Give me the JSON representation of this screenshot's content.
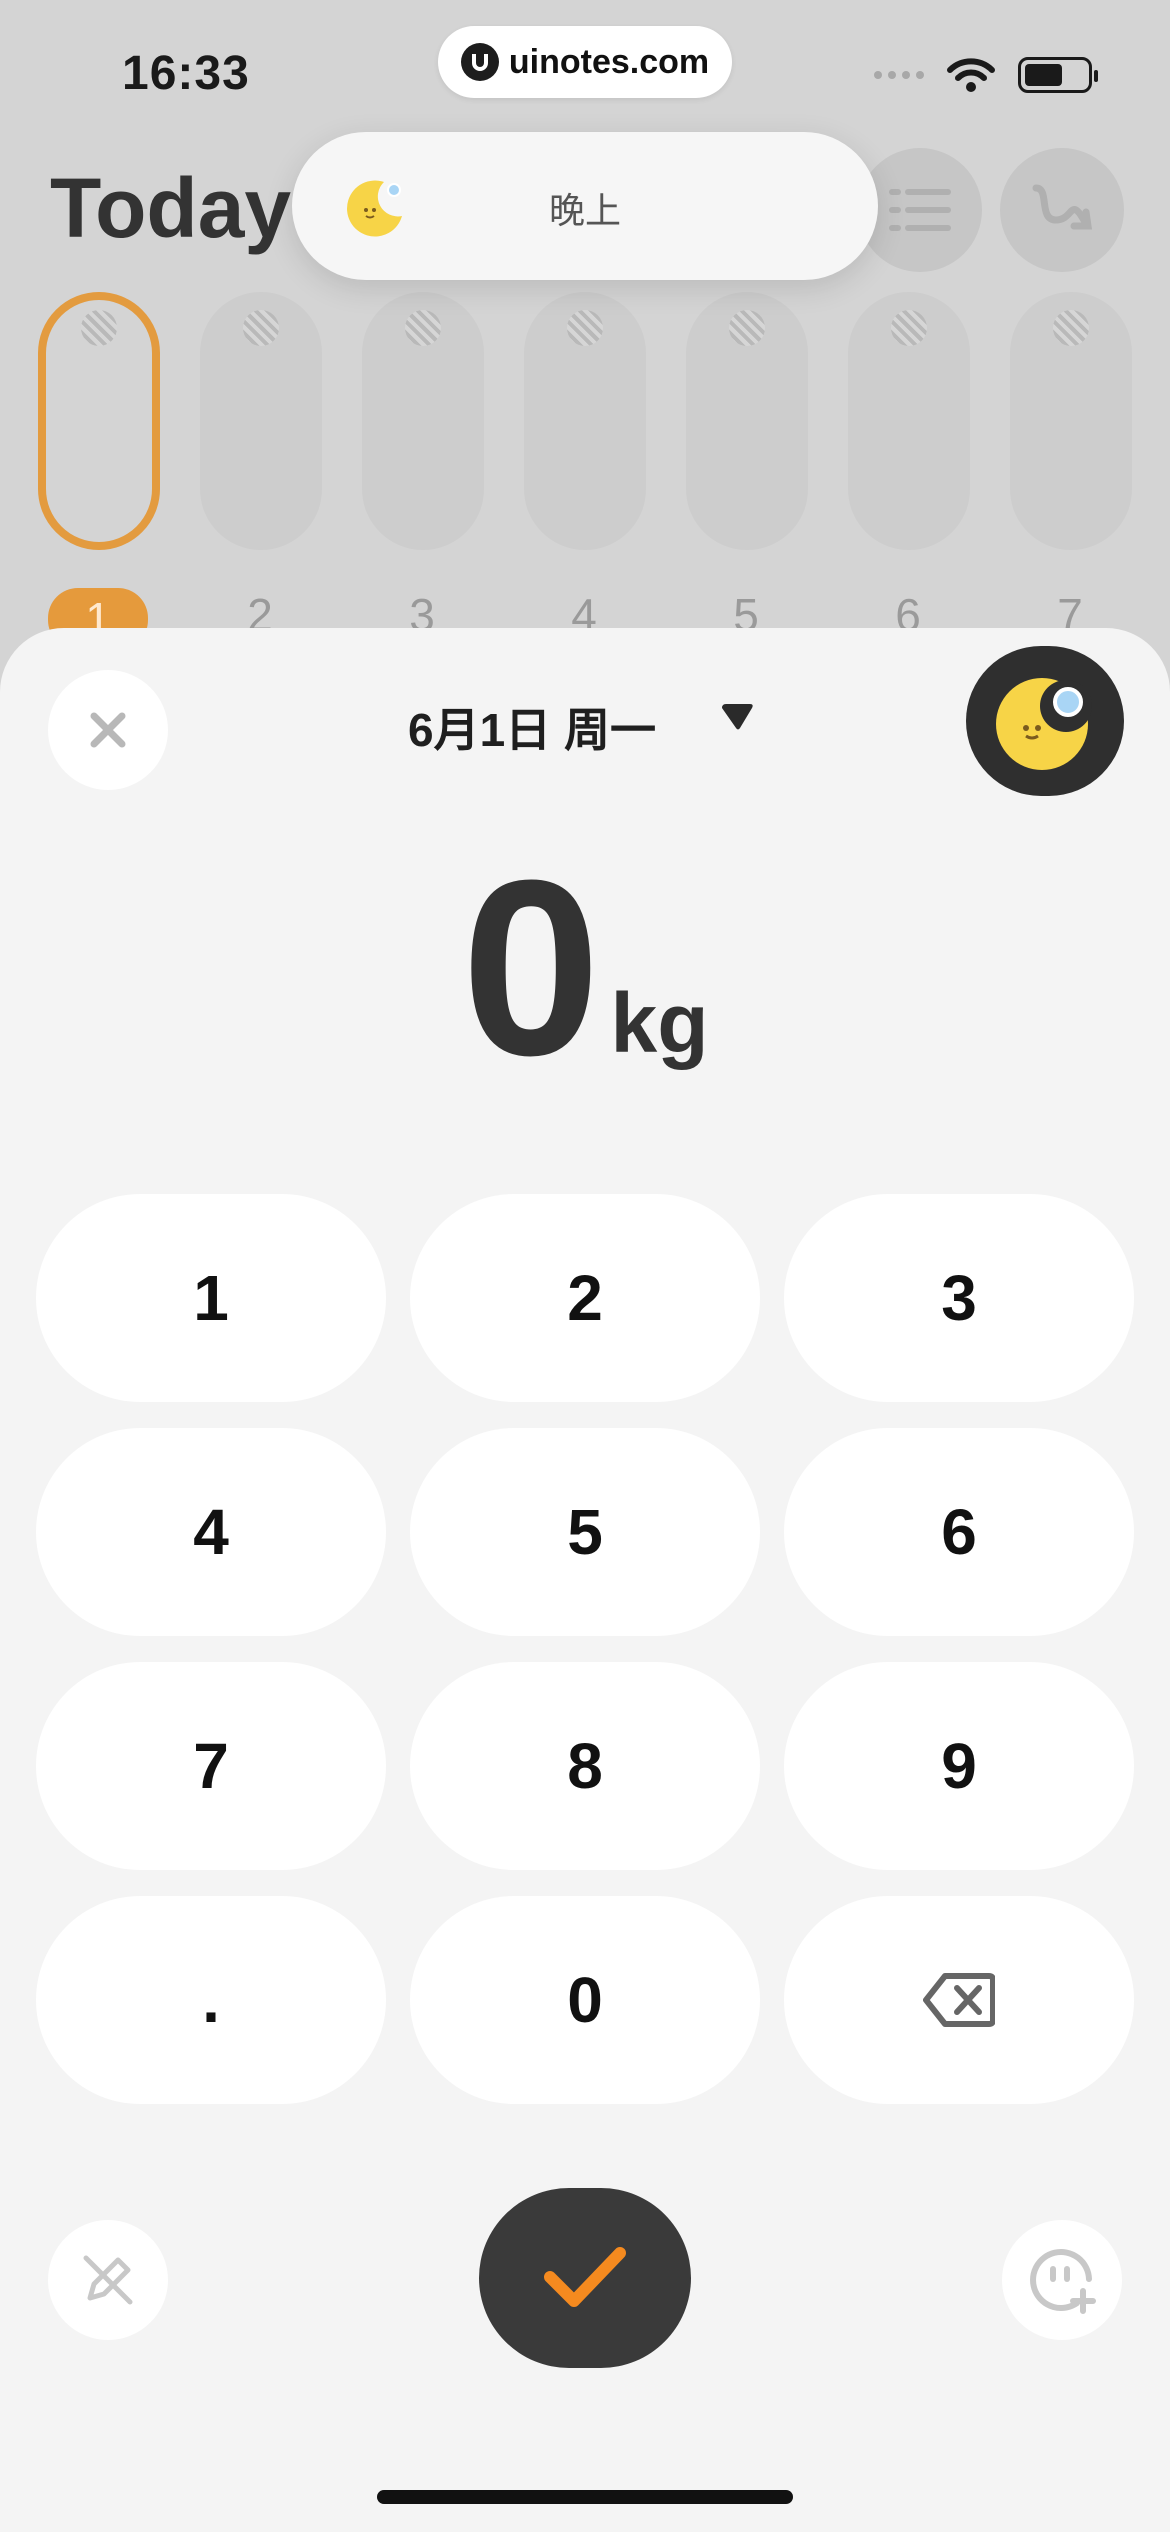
{
  "status_bar": {
    "time": "16:33",
    "url": "uinotes.com"
  },
  "background": {
    "title": "Today",
    "days": [
      "1",
      "2",
      "3",
      "4",
      "5",
      "6",
      "7"
    ],
    "active_day": "1",
    "active_color": "#e39b3f"
  },
  "toast": {
    "text": "晚上",
    "icon": "moon-icon"
  },
  "sheet": {
    "date": "6月1日 周一",
    "weight_value": "0",
    "weight_unit": "kg",
    "keys": [
      "1",
      "2",
      "3",
      "4",
      "5",
      "6",
      "7",
      "8",
      "9",
      ".",
      "0"
    ],
    "icons": {
      "close": "close-icon",
      "date_dropdown": "caret-down-icon",
      "time_of_day": "moon-icon",
      "delete": "backspace-icon",
      "edit": "pencil-icon",
      "confirm": "check-icon",
      "add_face": "add-face-icon"
    },
    "confirm_check_color": "#f58a1f"
  }
}
